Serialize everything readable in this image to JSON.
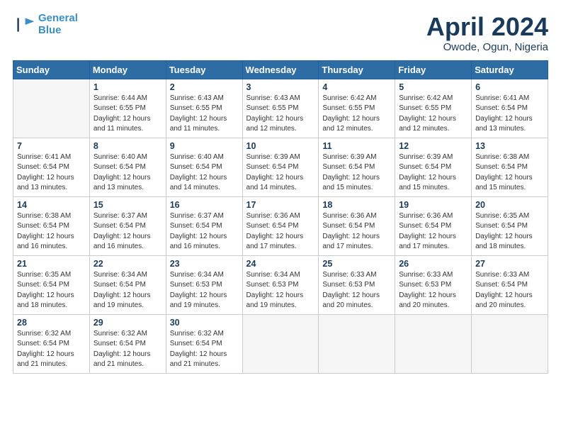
{
  "logo": {
    "line1": "General",
    "line2": "Blue"
  },
  "title": "April 2024",
  "location": "Owode, Ogun, Nigeria",
  "days_header": [
    "Sunday",
    "Monday",
    "Tuesday",
    "Wednesday",
    "Thursday",
    "Friday",
    "Saturday"
  ],
  "weeks": [
    [
      {
        "num": "",
        "empty": true
      },
      {
        "num": "1",
        "rise": "6:44 AM",
        "set": "6:55 PM",
        "daylight": "12 hours and 11 minutes."
      },
      {
        "num": "2",
        "rise": "6:43 AM",
        "set": "6:55 PM",
        "daylight": "12 hours and 11 minutes."
      },
      {
        "num": "3",
        "rise": "6:43 AM",
        "set": "6:55 PM",
        "daylight": "12 hours and 12 minutes."
      },
      {
        "num": "4",
        "rise": "6:42 AM",
        "set": "6:55 PM",
        "daylight": "12 hours and 12 minutes."
      },
      {
        "num": "5",
        "rise": "6:42 AM",
        "set": "6:55 PM",
        "daylight": "12 hours and 12 minutes."
      },
      {
        "num": "6",
        "rise": "6:41 AM",
        "set": "6:54 PM",
        "daylight": "12 hours and 13 minutes."
      }
    ],
    [
      {
        "num": "7",
        "rise": "6:41 AM",
        "set": "6:54 PM",
        "daylight": "12 hours and 13 minutes."
      },
      {
        "num": "8",
        "rise": "6:40 AM",
        "set": "6:54 PM",
        "daylight": "12 hours and 13 minutes."
      },
      {
        "num": "9",
        "rise": "6:40 AM",
        "set": "6:54 PM",
        "daylight": "12 hours and 14 minutes."
      },
      {
        "num": "10",
        "rise": "6:39 AM",
        "set": "6:54 PM",
        "daylight": "12 hours and 14 minutes."
      },
      {
        "num": "11",
        "rise": "6:39 AM",
        "set": "6:54 PM",
        "daylight": "12 hours and 15 minutes."
      },
      {
        "num": "12",
        "rise": "6:39 AM",
        "set": "6:54 PM",
        "daylight": "12 hours and 15 minutes."
      },
      {
        "num": "13",
        "rise": "6:38 AM",
        "set": "6:54 PM",
        "daylight": "12 hours and 15 minutes."
      }
    ],
    [
      {
        "num": "14",
        "rise": "6:38 AM",
        "set": "6:54 PM",
        "daylight": "12 hours and 16 minutes."
      },
      {
        "num": "15",
        "rise": "6:37 AM",
        "set": "6:54 PM",
        "daylight": "12 hours and 16 minutes."
      },
      {
        "num": "16",
        "rise": "6:37 AM",
        "set": "6:54 PM",
        "daylight": "12 hours and 16 minutes."
      },
      {
        "num": "17",
        "rise": "6:36 AM",
        "set": "6:54 PM",
        "daylight": "12 hours and 17 minutes."
      },
      {
        "num": "18",
        "rise": "6:36 AM",
        "set": "6:54 PM",
        "daylight": "12 hours and 17 minutes."
      },
      {
        "num": "19",
        "rise": "6:36 AM",
        "set": "6:54 PM",
        "daylight": "12 hours and 17 minutes."
      },
      {
        "num": "20",
        "rise": "6:35 AM",
        "set": "6:54 PM",
        "daylight": "12 hours and 18 minutes."
      }
    ],
    [
      {
        "num": "21",
        "rise": "6:35 AM",
        "set": "6:54 PM",
        "daylight": "12 hours and 18 minutes."
      },
      {
        "num": "22",
        "rise": "6:34 AM",
        "set": "6:54 PM",
        "daylight": "12 hours and 19 minutes."
      },
      {
        "num": "23",
        "rise": "6:34 AM",
        "set": "6:53 PM",
        "daylight": "12 hours and 19 minutes."
      },
      {
        "num": "24",
        "rise": "6:34 AM",
        "set": "6:53 PM",
        "daylight": "12 hours and 19 minutes."
      },
      {
        "num": "25",
        "rise": "6:33 AM",
        "set": "6:53 PM",
        "daylight": "12 hours and 20 minutes."
      },
      {
        "num": "26",
        "rise": "6:33 AM",
        "set": "6:53 PM",
        "daylight": "12 hours and 20 minutes."
      },
      {
        "num": "27",
        "rise": "6:33 AM",
        "set": "6:54 PM",
        "daylight": "12 hours and 20 minutes."
      }
    ],
    [
      {
        "num": "28",
        "rise": "6:32 AM",
        "set": "6:54 PM",
        "daylight": "12 hours and 21 minutes."
      },
      {
        "num": "29",
        "rise": "6:32 AM",
        "set": "6:54 PM",
        "daylight": "12 hours and 21 minutes."
      },
      {
        "num": "30",
        "rise": "6:32 AM",
        "set": "6:54 PM",
        "daylight": "12 hours and 21 minutes."
      },
      {
        "num": "",
        "empty": true
      },
      {
        "num": "",
        "empty": true
      },
      {
        "num": "",
        "empty": true
      },
      {
        "num": "",
        "empty": true
      }
    ]
  ]
}
